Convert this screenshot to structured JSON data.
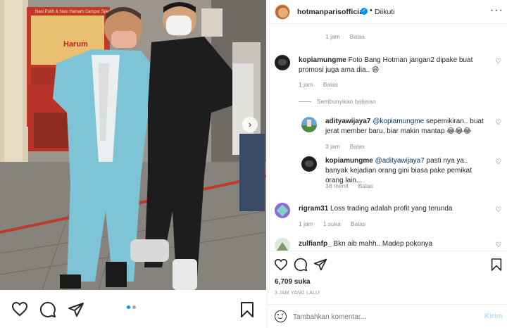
{
  "post": {
    "author": "hotmanparisofficial",
    "follow_status": "Diikuti",
    "likes": "6,709 suka",
    "time": "3 JAM YANG LALU",
    "photo": {
      "sign_line1": "Nasi Putih & Nasi Hainam Campur Special",
      "sign_line2": "Harum"
    }
  },
  "top_meta": {
    "time": "1 jam",
    "reply": "Balas"
  },
  "comments": [
    {
      "user": "kopiamungme",
      "text": "Foto Bang Hotman jangan2 dipake buat promosi juga ama dia.. 😄",
      "time": "1 jam",
      "reply": "Balas",
      "toggle": "Sembunyikan balasan",
      "replies": [
        {
          "user": "adityawijaya7",
          "mention": "@kopiamungme",
          "text": " sepemikiran.. buat jerat member baru, biar makin mantap 😂😂😂",
          "time": "3 jam",
          "reply": "Balas"
        },
        {
          "user": "kopiamungme",
          "mention": "@adityawijaya7",
          "text": " pasti nya ya.. banyak kejadian orang gini biasa pake pemikat orang lain...",
          "time": "38 menit",
          "reply": "Balas"
        }
      ]
    },
    {
      "user": "rigram31",
      "text": "Loss trading adalah profit yang terunda",
      "time": "1 jam",
      "likes": "1 suka",
      "reply": "Balas"
    },
    {
      "user": "zulfianfp_",
      "text": "Bkn aib mahh.. Madep pokonya"
    }
  ],
  "add_comment": {
    "placeholder": "Tambahkan komentar...",
    "send": "Kirim"
  },
  "colors": {
    "verified": "#0095f6",
    "send_disabled": "#b2dffc",
    "mention": "#00376b"
  }
}
